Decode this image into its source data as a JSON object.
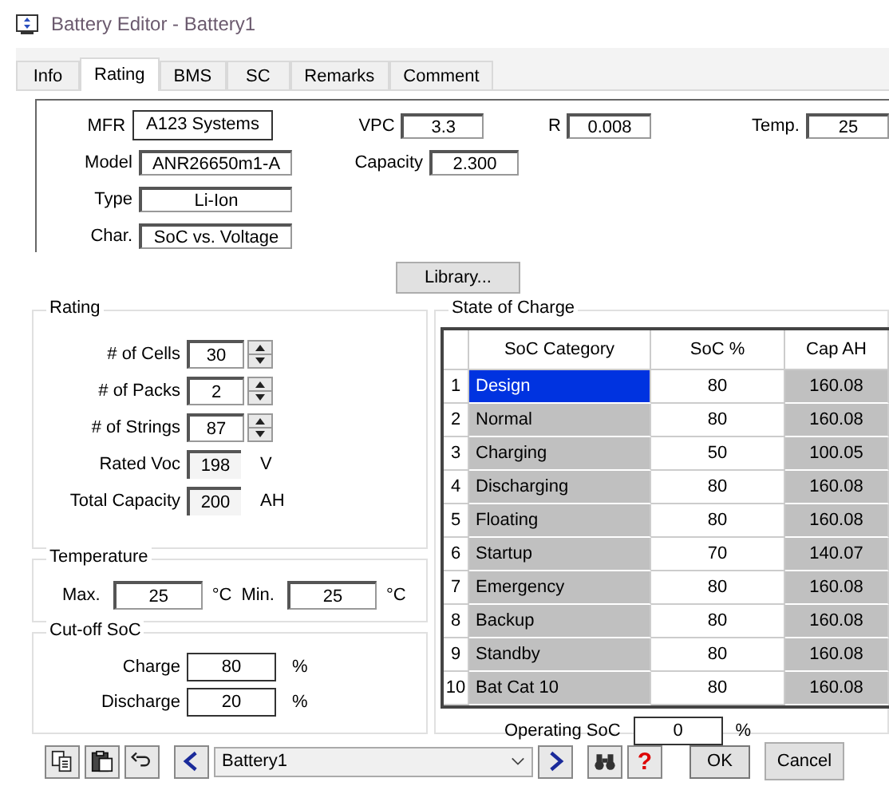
{
  "window": {
    "title": "Battery Editor - Battery1"
  },
  "tabs": [
    {
      "label": "Info",
      "selected": false
    },
    {
      "label": "Rating",
      "selected": true
    },
    {
      "label": "BMS",
      "selected": false
    },
    {
      "label": "SC",
      "selected": false
    },
    {
      "label": "Remarks",
      "selected": false
    },
    {
      "label": "Comment",
      "selected": false
    }
  ],
  "general": {
    "rows": [
      [
        {
          "label": "MFR",
          "value": "A123 Systems"
        },
        {
          "label": "VPC",
          "value": "3.3"
        },
        {
          "label": "R",
          "value": "0.008"
        },
        {
          "label": "Temp.",
          "value": "25"
        }
      ],
      [
        {
          "label": "Model",
          "value": "ANR26650m1-A"
        },
        {
          "label": "Capacity",
          "value": "2.300"
        }
      ],
      [
        {
          "label": "Type",
          "value": "Li-Ion"
        }
      ],
      [
        {
          "label": "Char.",
          "value": "SoC vs. Voltage"
        }
      ]
    ]
  },
  "library_button": "Library...",
  "rating": {
    "title": "Rating",
    "fields": [
      {
        "kind": "spin",
        "label": "# of Cells",
        "value": "30"
      },
      {
        "kind": "spin",
        "label": "# of Packs",
        "value": "2"
      },
      {
        "kind": "spin",
        "label": "# of Strings",
        "value": "87"
      },
      {
        "kind": "readonly",
        "label": "Rated Voc",
        "value": "198",
        "unit": "V"
      },
      {
        "kind": "readonly",
        "label": "Total Capacity",
        "value": "200",
        "unit": "AH"
      }
    ]
  },
  "temperature": {
    "title": "Temperature",
    "fields": [
      {
        "label": "Max.",
        "value": "25",
        "unit": "°C"
      },
      {
        "label": "Min.",
        "value": "25",
        "unit": "°C"
      }
    ]
  },
  "cutoff": {
    "title": "Cut-off SoC",
    "fields": [
      {
        "label": "Charge",
        "value": "80",
        "unit": "%"
      },
      {
        "label": "Discharge",
        "value": "20",
        "unit": "%"
      }
    ]
  },
  "soc": {
    "title": "State of Charge",
    "columns": [
      "SoC Category",
      "SoC %",
      "Cap AH"
    ],
    "rows": [
      {
        "index": "1",
        "category": "Design",
        "soc": "80",
        "cap": "160.08",
        "selected": true
      },
      {
        "index": "2",
        "category": "Normal",
        "soc": "80",
        "cap": "160.08",
        "selected": false
      },
      {
        "index": "3",
        "category": "Charging",
        "soc": "50",
        "cap": "100.05",
        "selected": false
      },
      {
        "index": "4",
        "category": "Discharging",
        "soc": "80",
        "cap": "160.08",
        "selected": false
      },
      {
        "index": "5",
        "category": "Floating",
        "soc": "80",
        "cap": "160.08",
        "selected": false
      },
      {
        "index": "6",
        "category": "Startup",
        "soc": "70",
        "cap": "140.07",
        "selected": false
      },
      {
        "index": "7",
        "category": "Emergency",
        "soc": "80",
        "cap": "160.08",
        "selected": false
      },
      {
        "index": "8",
        "category": "Backup",
        "soc": "80",
        "cap": "160.08",
        "selected": false
      },
      {
        "index": "9",
        "category": "Standby",
        "soc": "80",
        "cap": "160.08",
        "selected": false
      },
      {
        "index": "10",
        "category": "Bat Cat 10",
        "soc": "80",
        "cap": "160.08",
        "selected": false
      }
    ],
    "operating": {
      "label": "Operating SoC",
      "value": "0",
      "unit": "%"
    }
  },
  "toolbar": {
    "battery": "Battery1",
    "help_glyph": "?",
    "ok": "OK",
    "cancel": "Cancel"
  }
}
